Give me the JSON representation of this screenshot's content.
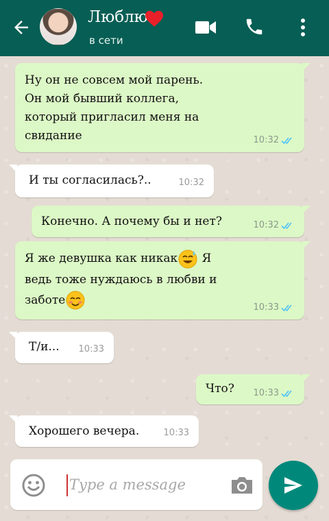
{
  "header": {
    "contact_name": "Люблю",
    "status": "в сети",
    "icons": [
      "back-arrow-icon",
      "heart-icon",
      "video-call-icon",
      "phone-icon",
      "more-vert-icon"
    ],
    "bar_color": "#075e54"
  },
  "messages": [
    {
      "direction": "out",
      "text": "Ну он не совсем мой парень.\nОн мой бывший коллега,\nкоторый пригласил меня на\nсвидание",
      "time": "10:32",
      "read": true
    },
    {
      "direction": "in",
      "text": "И ты согласилась?..",
      "time": "10:32"
    },
    {
      "direction": "out",
      "text": "Конечно. А почему бы и нет?",
      "time": "10:32",
      "read": true
    },
    {
      "direction": "out",
      "text_parts": [
        "Я же девушка как никак",
        " Я\nведь тоже нуждаюсь в любви и\nзаботе"
      ],
      "emojis": [
        "sweat-smile-emoji",
        "blush-emoji"
      ],
      "time": "10:33",
      "read": true
    },
    {
      "direction": "in",
      "text": "Т/и...",
      "time": "10:33"
    },
    {
      "direction": "out",
      "text": "Что?",
      "time": "10:33",
      "read": true
    },
    {
      "direction": "in",
      "text": "Хорошего вечера.",
      "time": "10:33"
    }
  ],
  "input": {
    "placeholder": "Type a message",
    "value": ""
  },
  "colors": {
    "outgoing_bubble": "#dcf8c6",
    "incoming_bubble": "#ffffff",
    "read_ticks": "#4fc3f7",
    "send_button": "#00897b"
  }
}
